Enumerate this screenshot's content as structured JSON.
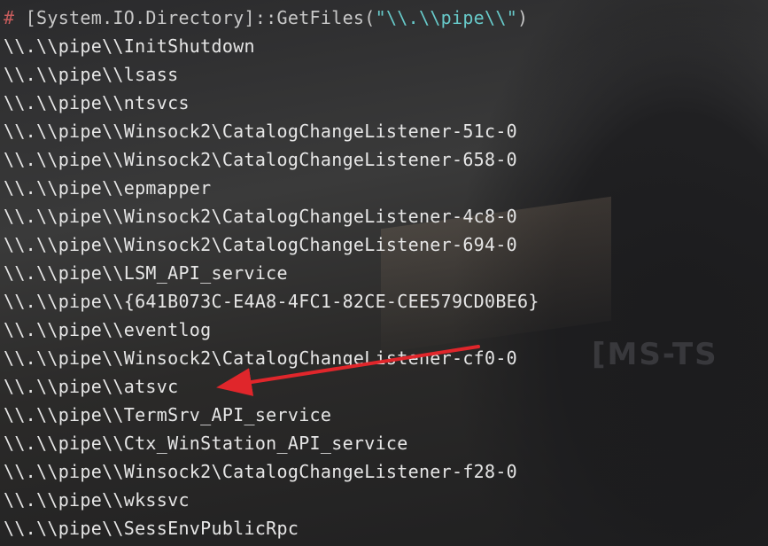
{
  "terminal": {
    "prompt": "#",
    "command_prefix": " [System.IO.Directory]::GetFiles(",
    "command_arg": "\"\\\\.\\\\pipe\\\\\"",
    "command_suffix": ")",
    "output": [
      "\\\\.\\\\pipe\\\\InitShutdown",
      "\\\\.\\\\pipe\\\\lsass",
      "\\\\.\\\\pipe\\\\ntsvcs",
      "\\\\.\\\\pipe\\\\Winsock2\\CatalogChangeListener-51c-0",
      "\\\\.\\\\pipe\\\\Winsock2\\CatalogChangeListener-658-0",
      "\\\\.\\\\pipe\\\\epmapper",
      "\\\\.\\\\pipe\\\\Winsock2\\CatalogChangeListener-4c8-0",
      "\\\\.\\\\pipe\\\\Winsock2\\CatalogChangeListener-694-0",
      "\\\\.\\\\pipe\\\\LSM_API_service",
      "\\\\.\\\\pipe\\\\{641B073C-E4A8-4FC1-82CE-CEE579CD0BE6}",
      "\\\\.\\\\pipe\\\\eventlog",
      "\\\\.\\\\pipe\\\\Winsock2\\CatalogChangeListener-cf0-0",
      "\\\\.\\\\pipe\\\\atsvc",
      "\\\\.\\\\pipe\\\\TermSrv_API_service",
      "\\\\.\\\\pipe\\\\Ctx_WinStation_API_service",
      "\\\\.\\\\pipe\\\\Winsock2\\CatalogChangeListener-f28-0",
      "\\\\.\\\\pipe\\\\wkssvc",
      "\\\\.\\\\pipe\\\\SessEnvPublicRpc"
    ]
  },
  "background": {
    "watermark_text": "[MS-TS"
  },
  "annotation": {
    "arrow_color": "#e0262b",
    "points_to": "\\\\.\\\\pipe\\\\atsvc"
  },
  "colors": {
    "prompt": "#c65c5c",
    "string": "#67c9c9",
    "text": "#e6e6e6"
  }
}
